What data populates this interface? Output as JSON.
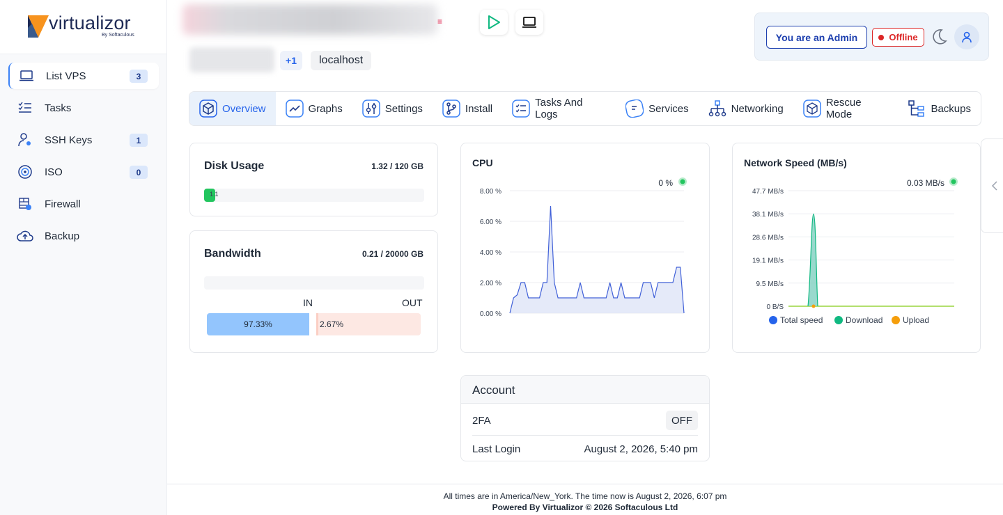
{
  "brand": {
    "name": "virtualizor",
    "sub": "By Softaculous"
  },
  "sidebar": {
    "items": [
      {
        "label": "List VPS",
        "badge": "3",
        "icon": "laptop-icon",
        "active": true
      },
      {
        "label": "Tasks",
        "badge": "",
        "icon": "checklist-icon"
      },
      {
        "label": "SSH Keys",
        "badge": "1",
        "icon": "user-key-icon"
      },
      {
        "label": "ISO",
        "badge": "0",
        "icon": "disc-icon"
      },
      {
        "label": "Firewall",
        "badge": "",
        "icon": "firewall-icon"
      },
      {
        "label": "Backup",
        "badge": "",
        "icon": "cloud-upload-icon"
      }
    ]
  },
  "header": {
    "extra_count": "+1",
    "hostname": "localhost"
  },
  "admin": {
    "role_label": "You are an Admin",
    "status_label": "Offline"
  },
  "tabs": [
    {
      "label": "Overview",
      "icon": "cube-icon",
      "active": true
    },
    {
      "label": "Graphs",
      "icon": "chart-line-icon"
    },
    {
      "label": "Settings",
      "icon": "sliders-icon"
    },
    {
      "label": "Install",
      "icon": "git-icon"
    },
    {
      "label": "Tasks And Logs",
      "icon": "tasks-icon"
    },
    {
      "label": "Services",
      "icon": "services-icon"
    },
    {
      "label": "Networking",
      "icon": "network-icon"
    },
    {
      "label": "Rescue Mode",
      "icon": "rescue-icon"
    },
    {
      "label": "Backups",
      "icon": "backups-icon"
    }
  ],
  "disk": {
    "title": "Disk Usage",
    "value": "1.32 / 120 GB",
    "percent_label": "1.1",
    "fraction": 0.011
  },
  "bandwidth": {
    "title": "Bandwidth",
    "value": "0.21 / 20000 GB",
    "in_label": "IN",
    "out_label": "OUT",
    "in_pct": "97.33%",
    "out_pct": "2.67%",
    "in_fraction": 0.9733
  },
  "chart_data": [
    {
      "type": "area",
      "title": "CPU",
      "current": "0 %",
      "ylim": [
        0,
        8
      ],
      "y_ticks": [
        "8.00 %",
        "6.00 %",
        "4.00 %",
        "2.00 %",
        "0.00 %"
      ],
      "series": [
        {
          "values": [
            0,
            1,
            1.2,
            2,
            2,
            1,
            1,
            1,
            1,
            2,
            2,
            7,
            2,
            1,
            1,
            1,
            1,
            1,
            1,
            2,
            1,
            1,
            1,
            1,
            1,
            1,
            1,
            2,
            1,
            1,
            2,
            1,
            1,
            1,
            1,
            1,
            2,
            2,
            2,
            1,
            2,
            2,
            2,
            2,
            2,
            3,
            3,
            0
          ]
        }
      ],
      "color": "#4060d8"
    },
    {
      "type": "area",
      "title": "Network Speed (MB/s)",
      "current": "0.03 MB/s",
      "ylim": [
        0,
        47.7
      ],
      "y_ticks": [
        "47.7 MB/s",
        "38.1 MB/s",
        "28.6 MB/s",
        "19.1 MB/s",
        "9.5 MB/s",
        "0 B/S"
      ],
      "series": [
        {
          "name": "Total speed",
          "color": "#2563eb",
          "values": [
            0,
            0,
            0,
            0,
            0,
            0,
            0,
            0,
            0,
            0,
            0,
            0,
            0,
            0,
            0,
            0,
            0,
            0,
            0,
            0,
            0,
            0,
            0,
            0,
            0,
            0,
            0,
            0,
            0,
            0,
            0,
            0,
            0,
            0,
            0,
            0,
            0,
            0,
            0,
            0,
            0,
            0,
            0,
            0,
            0,
            0,
            0,
            0,
            0,
            0,
            0,
            0,
            0,
            0,
            0,
            0,
            0,
            0,
            0,
            0,
            0,
            0
          ]
        },
        {
          "name": "Download",
          "color": "#10b981",
          "values": [
            0,
            0,
            0,
            0,
            0,
            0,
            0,
            0,
            0,
            0,
            0,
            0,
            0,
            0,
            0,
            0,
            0,
            0,
            0,
            0,
            0,
            0,
            0,
            0,
            0,
            0,
            0,
            0,
            0,
            0,
            0,
            0,
            0,
            0,
            0,
            0,
            0,
            0,
            0,
            0,
            0,
            0,
            0,
            0,
            0,
            0,
            0,
            0,
            0,
            0,
            0,
            0,
            0,
            0,
            0,
            0,
            0,
            0,
            0,
            0,
            0,
            0
          ]
        },
        {
          "name": "Upload",
          "color": "#f59e0b",
          "values": []
        }
      ],
      "spike": {
        "index": 1,
        "peak": 38.1
      }
    }
  ],
  "account": {
    "title": "Account",
    "rows": [
      {
        "label": "2FA",
        "value": "OFF"
      },
      {
        "label": "Last Login",
        "value": "August 2, 2026, 5:40 pm"
      }
    ]
  },
  "footer": {
    "line1": "All times are in America/New_York. The time now is August 2, 2026, 6:07 pm",
    "line2": "Powered By Virtualizor © 2026 Softaculous Ltd"
  },
  "colors": {
    "accent": "#2563eb",
    "offline": "#dc2626",
    "disk": "#22c55e",
    "bw_in": "#93c5fd",
    "bw_out": "#fde8e3"
  }
}
